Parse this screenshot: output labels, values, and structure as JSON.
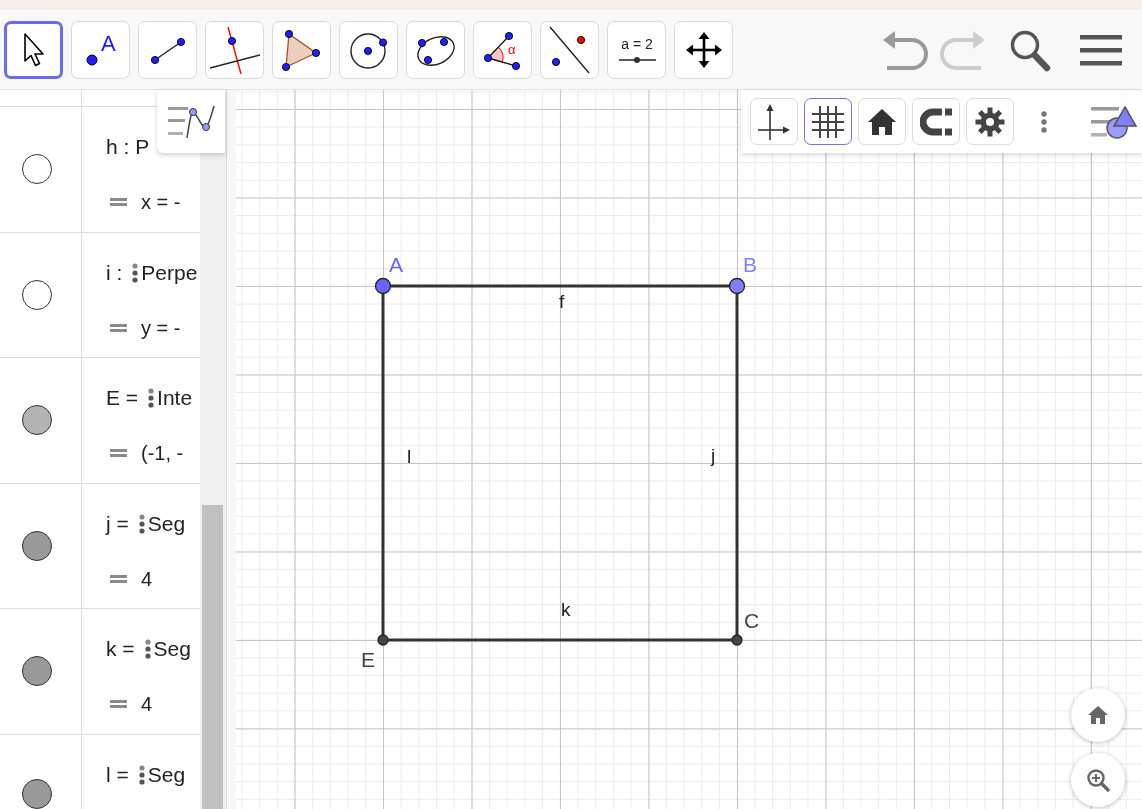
{
  "toolbar": {
    "tools": [
      {
        "kind": "move",
        "selected": true
      },
      {
        "kind": "point",
        "selected": false,
        "glyph": "A"
      },
      {
        "kind": "segment",
        "selected": false
      },
      {
        "kind": "perpendicular",
        "selected": false
      },
      {
        "kind": "polygon",
        "selected": false
      },
      {
        "kind": "circle",
        "selected": false
      },
      {
        "kind": "conic",
        "selected": false
      },
      {
        "kind": "angle",
        "selected": false,
        "glyph": "α"
      },
      {
        "kind": "reflect",
        "selected": false
      },
      {
        "kind": "slider",
        "selected": false,
        "glyph": "a = 2"
      },
      {
        "kind": "move_view",
        "selected": false
      }
    ],
    "actions": [
      {
        "kind": "undo",
        "disabled": false
      },
      {
        "kind": "redo",
        "disabled": true
      },
      {
        "kind": "search"
      },
      {
        "kind": "menu"
      }
    ]
  },
  "algebra": {
    "items": [
      {
        "visible": false,
        "head": "h :",
        "definition": "P",
        "drag_handle": false,
        "value": "x = -"
      },
      {
        "visible": false,
        "head": "i :",
        "definition": "Perpe",
        "drag_handle": true,
        "value": "y = -"
      },
      {
        "visible": true,
        "color": "#b3b3b3",
        "head": "E =",
        "definition": "Inte",
        "drag_handle": true,
        "value": "(-1, -"
      },
      {
        "visible": true,
        "color": "#999999",
        "head": "j =",
        "definition": "Seg",
        "drag_handle": true,
        "value": "4"
      },
      {
        "visible": true,
        "color": "#999999",
        "head": "k =",
        "definition": "Seg",
        "drag_handle": true,
        "value": "4"
      },
      {
        "visible": true,
        "color": "#999999",
        "head": "l =",
        "definition": "Seg",
        "drag_handle": true
      }
    ]
  },
  "graphics": {
    "style_bar": [
      {
        "kind": "axes",
        "selected": false
      },
      {
        "kind": "grid",
        "selected": true
      },
      {
        "kind": "home",
        "selected": false
      },
      {
        "kind": "snap",
        "selected": false
      },
      {
        "kind": "settings",
        "selected": false
      }
    ],
    "segments": [
      {
        "label": "f"
      },
      {
        "label": "j"
      },
      {
        "label": "k"
      },
      {
        "label": "l"
      }
    ],
    "points": [
      {
        "label": "A",
        "kind": "free",
        "color": "#6666ff"
      },
      {
        "label": "B",
        "kind": "free",
        "color": "#8080ff"
      },
      {
        "label": "C",
        "kind": "dependent",
        "color": "#444444"
      },
      {
        "label": "E",
        "kind": "dependent",
        "color": "#444444"
      }
    ]
  }
}
